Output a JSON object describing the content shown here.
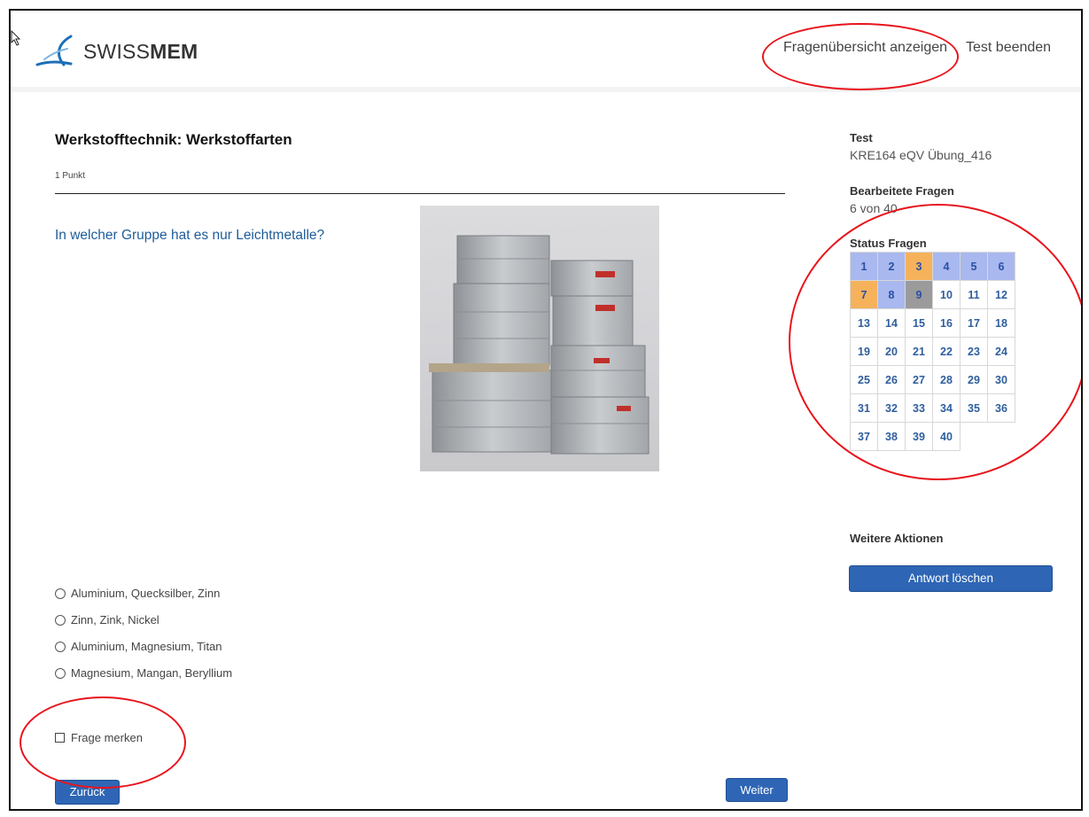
{
  "header": {
    "logo": {
      "prefix": "SWISS",
      "bold": "MEM"
    },
    "nav": {
      "overview_label": "Fragenübersicht anzeigen",
      "end_label": "Test beenden"
    }
  },
  "question": {
    "title": "Werkstofftechnik: Werkstoffarten",
    "points": "1 Punkt",
    "text": "In welcher Gruppe hat es nur Leichtmetalle?",
    "options": [
      "Aluminium, Quecksilber, Zinn",
      "Zinn, Zink, Nickel",
      "Aluminium, Magnesium, Titan",
      "Magnesium, Mangan, Beryllium"
    ],
    "mark_label": "Frage merken",
    "back_label": "Zurück",
    "next_label": "Weiter"
  },
  "sidebar": {
    "test_label": "Test",
    "test_value": "KRE164 eQV Übung_416",
    "done_label": "Bearbeitete Fragen",
    "done_value": "6 von 40",
    "status_label": "Status Fragen",
    "cells": [
      {
        "n": "1",
        "state": "answered"
      },
      {
        "n": "2",
        "state": "answered"
      },
      {
        "n": "3",
        "state": "marked"
      },
      {
        "n": "4",
        "state": "answered"
      },
      {
        "n": "5",
        "state": "answered"
      },
      {
        "n": "6",
        "state": "answered"
      },
      {
        "n": "7",
        "state": "marked"
      },
      {
        "n": "8",
        "state": "answered"
      },
      {
        "n": "9",
        "state": "current"
      },
      {
        "n": "10",
        "state": "open"
      },
      {
        "n": "11",
        "state": "open"
      },
      {
        "n": "12",
        "state": "open"
      },
      {
        "n": "13",
        "state": "open"
      },
      {
        "n": "14",
        "state": "open"
      },
      {
        "n": "15",
        "state": "open"
      },
      {
        "n": "16",
        "state": "open"
      },
      {
        "n": "17",
        "state": "open"
      },
      {
        "n": "18",
        "state": "open"
      },
      {
        "n": "19",
        "state": "open"
      },
      {
        "n": "20",
        "state": "open"
      },
      {
        "n": "21",
        "state": "open"
      },
      {
        "n": "22",
        "state": "open"
      },
      {
        "n": "23",
        "state": "open"
      },
      {
        "n": "24",
        "state": "open"
      },
      {
        "n": "25",
        "state": "open"
      },
      {
        "n": "26",
        "state": "open"
      },
      {
        "n": "27",
        "state": "open"
      },
      {
        "n": "28",
        "state": "open"
      },
      {
        "n": "29",
        "state": "open"
      },
      {
        "n": "30",
        "state": "open"
      },
      {
        "n": "31",
        "state": "open"
      },
      {
        "n": "32",
        "state": "open"
      },
      {
        "n": "33",
        "state": "open"
      },
      {
        "n": "34",
        "state": "open"
      },
      {
        "n": "35",
        "state": "open"
      },
      {
        "n": "36",
        "state": "open"
      },
      {
        "n": "37",
        "state": "open"
      },
      {
        "n": "38",
        "state": "open"
      },
      {
        "n": "39",
        "state": "open"
      },
      {
        "n": "40",
        "state": "open"
      }
    ],
    "actions_label": "Weitere Aktionen",
    "clear_label": "Antwort löschen"
  },
  "colors": {
    "accent": "#2e66b5",
    "answered": "#a9b8ee",
    "marked": "#f5b25b",
    "current": "#9b9b9b",
    "annotation": "#e8141c"
  }
}
